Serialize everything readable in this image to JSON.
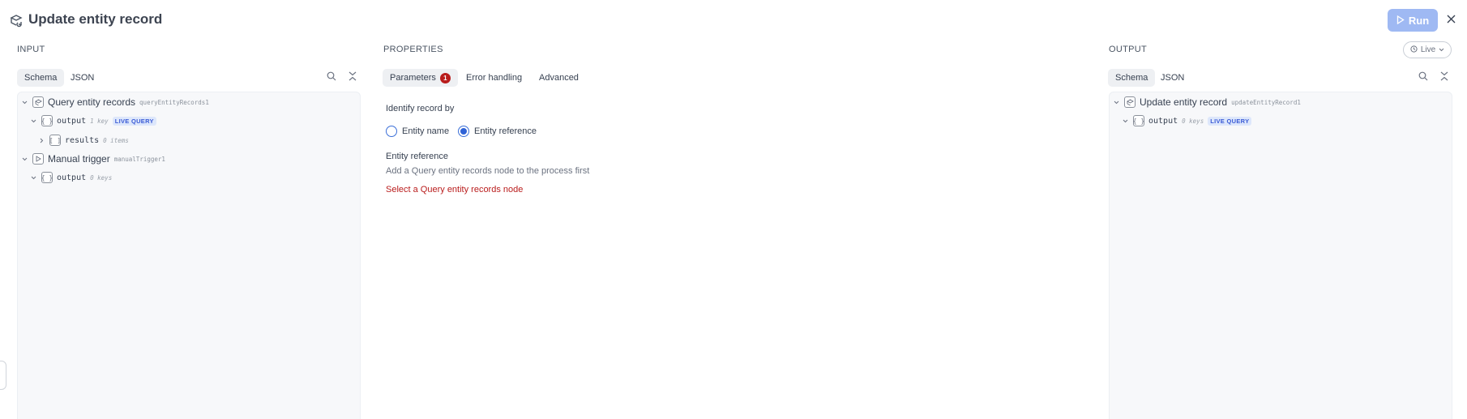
{
  "header": {
    "title": "Update entity record",
    "run_label": "Run"
  },
  "input": {
    "label": "INPUT",
    "tabs": [
      "Schema",
      "JSON"
    ],
    "tree": {
      "node1": {
        "title": "Query entity records",
        "sub": "queryEntityRecords1"
      },
      "node1_output": {
        "key": "output",
        "meta": "1 key",
        "badge": "LIVE QUERY"
      },
      "node1_results": {
        "key": "results",
        "meta": "0 items"
      },
      "node2": {
        "title": "Manual trigger",
        "sub": "manualTrigger1"
      },
      "node2_output": {
        "key": "output",
        "meta": "0 keys"
      }
    }
  },
  "properties": {
    "label": "PROPERTIES",
    "tabs": {
      "parameters": "Parameters",
      "parameters_count": "1",
      "error_handling": "Error handling",
      "advanced": "Advanced"
    },
    "identify_label": "Identify record by",
    "radio_entity_name": "Entity name",
    "radio_entity_reference": "Entity reference",
    "entity_reference_label": "Entity reference",
    "hint": "Add a Query entity records node to the process first",
    "error": "Select a Query entity records node"
  },
  "output": {
    "label": "OUTPUT",
    "live_label": "Live",
    "tabs": [
      "Schema",
      "JSON"
    ],
    "tree": {
      "node1": {
        "title": "Update entity record",
        "sub": "updateEntityRecord1"
      },
      "node1_output": {
        "key": "output",
        "meta": "0 keys",
        "badge": "LIVE QUERY"
      }
    }
  },
  "colors": {
    "accent": "#2f62d6",
    "run_button": "#9fb9f3",
    "error": "#b91c1c",
    "badge_bg": "#dde7fb"
  }
}
